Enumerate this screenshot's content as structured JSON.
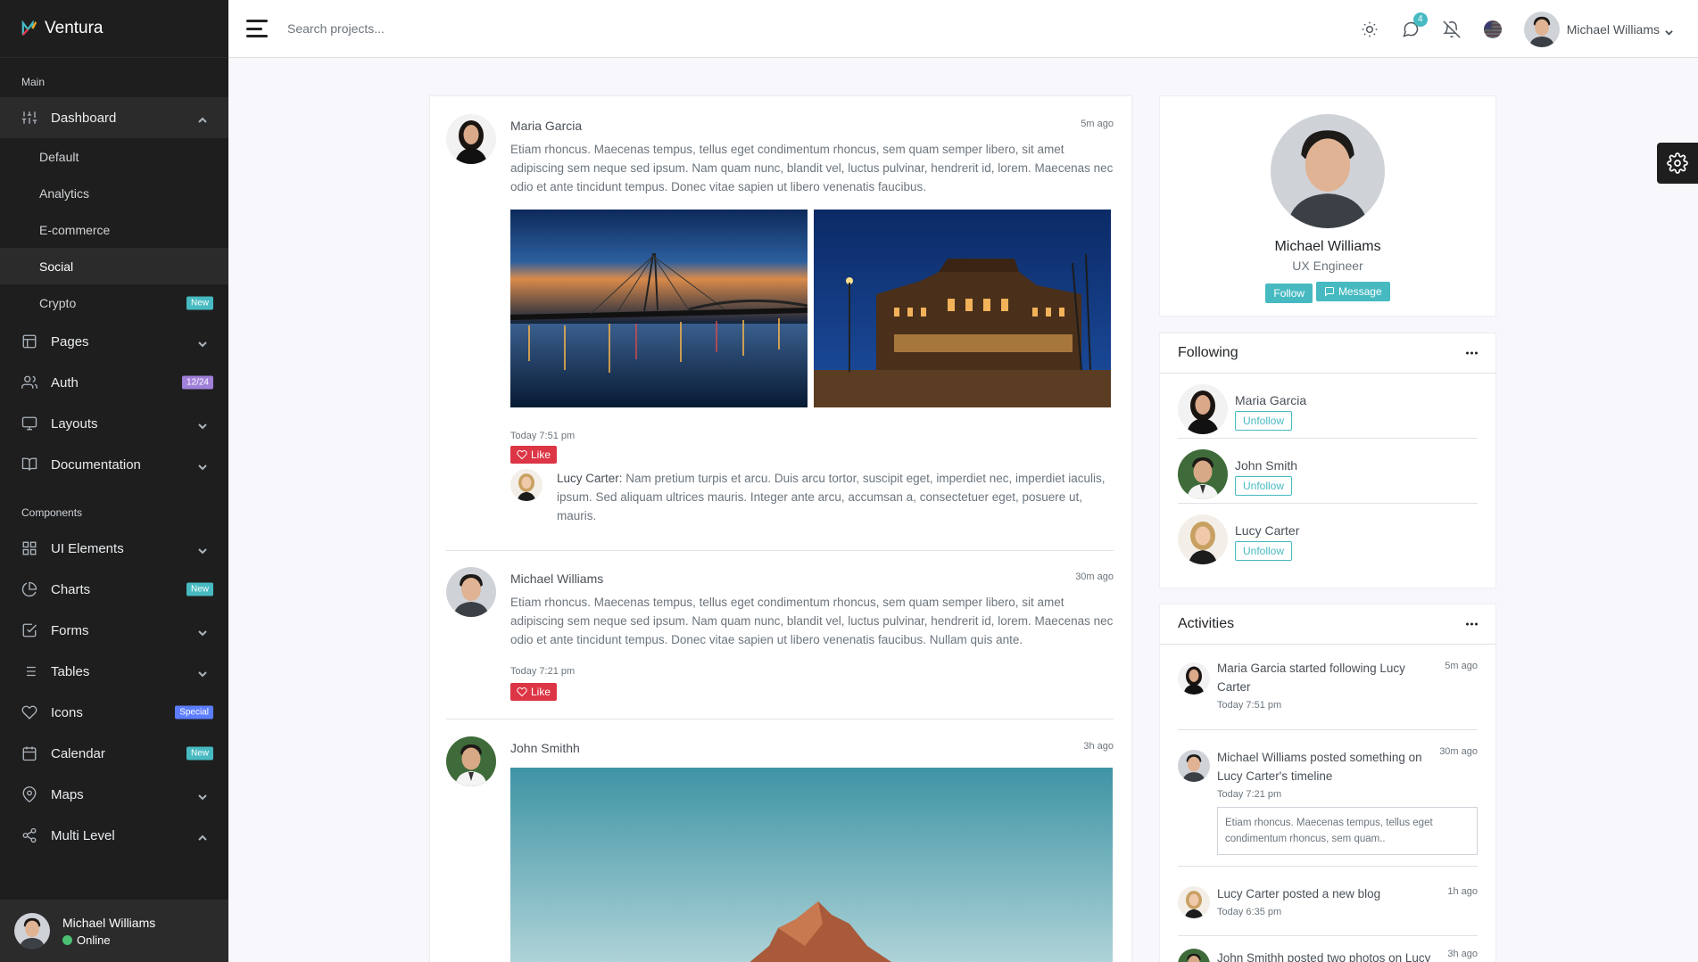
{
  "brand": {
    "name": "Ventura"
  },
  "sidebar": {
    "section_main": "Main",
    "section_components": "Components",
    "dashboard": {
      "label": "Dashboard",
      "items": [
        {
          "label": "Default"
        },
        {
          "label": "Analytics"
        },
        {
          "label": "E-commerce"
        },
        {
          "label": "Social",
          "active": true
        },
        {
          "label": "Crypto",
          "badge": "New"
        }
      ]
    },
    "pages": {
      "label": "Pages"
    },
    "auth": {
      "label": "Auth",
      "badge": "12/24"
    },
    "layouts": {
      "label": "Layouts"
    },
    "documentation": {
      "label": "Documentation"
    },
    "ui_elements": {
      "label": "UI Elements"
    },
    "charts": {
      "label": "Charts",
      "badge": "New"
    },
    "forms": {
      "label": "Forms"
    },
    "tables": {
      "label": "Tables"
    },
    "icons": {
      "label": "Icons",
      "badge": "Special"
    },
    "calendar": {
      "label": "Calendar",
      "badge": "New"
    },
    "maps": {
      "label": "Maps"
    },
    "multi_level": {
      "label": "Multi Level"
    },
    "user": {
      "name": "Michael Williams",
      "status": "Online"
    }
  },
  "topbar": {
    "search_placeholder": "Search projects...",
    "messages_count": "4",
    "user_name": "Michael Williams"
  },
  "posts": [
    {
      "author": "Maria Garcia",
      "ago": "5m ago",
      "text": "Etiam rhoncus. Maecenas tempus, tellus eget condimentum rhoncus, sem quam semper libero, sit amet adipiscing sem neque sed ipsum. Nam quam nunc, blandit vel, luctus pulvinar, hendrerit id, lorem. Maecenas nec odio et ante tincidunt tempus. Donec vitae sapien ut libero venenatis faucibus.",
      "time": "Today 7:51 pm",
      "like_label": "Like",
      "comment": {
        "author": "Lucy Carter:",
        "text": "Nam pretium turpis et arcu. Duis arcu tortor, suscipit eget, imperdiet nec, imperdiet iaculis, ipsum. Sed aliquam ultrices mauris. Integer ante arcu, accumsan a, consectetuer eget, posuere ut, mauris."
      }
    },
    {
      "author": "Michael Williams",
      "ago": "30m ago",
      "text": "Etiam rhoncus. Maecenas tempus, tellus eget condimentum rhoncus, sem quam semper libero, sit amet adipiscing sem neque sed ipsum. Nam quam nunc, blandit vel, luctus pulvinar, hendrerit id, lorem. Maecenas nec odio et ante tincidunt tempus. Donec vitae sapien ut libero venenatis faucibus. Nullam quis ante.",
      "time": "Today 7:21 pm",
      "like_label": "Like"
    },
    {
      "author": "John Smithh",
      "ago": "3h ago"
    }
  ],
  "profile": {
    "name": "Michael Williams",
    "role": "UX Engineer",
    "follow_label": "Follow",
    "message_label": "Message"
  },
  "following": {
    "title": "Following",
    "people": [
      {
        "name": "Maria Garcia",
        "action": "Unfollow"
      },
      {
        "name": "John Smith",
        "action": "Unfollow"
      },
      {
        "name": "Lucy Carter",
        "action": "Unfollow"
      }
    ]
  },
  "activities": {
    "title": "Activities",
    "items": [
      {
        "text": "Maria Garcia started following Lucy Carter",
        "time": "Today 7:51 pm",
        "ago": "5m ago"
      },
      {
        "text": "Michael Williams posted something on Lucy Carter's timeline",
        "time": "Today 7:21 pm",
        "ago": "30m ago",
        "quote": "Etiam rhoncus. Maecenas tempus, tellus eget condimentum rhoncus, sem quam.."
      },
      {
        "text": "Lucy Carter posted a new blog",
        "time": "Today 6:35 pm",
        "ago": "1h ago"
      },
      {
        "text": "John Smithh posted two photos on Lucy",
        "ago": "3h ago"
      }
    ]
  },
  "colors": {
    "accent": "#47bac1",
    "danger": "#dc3545",
    "sidebar": "#1e1e1e"
  }
}
